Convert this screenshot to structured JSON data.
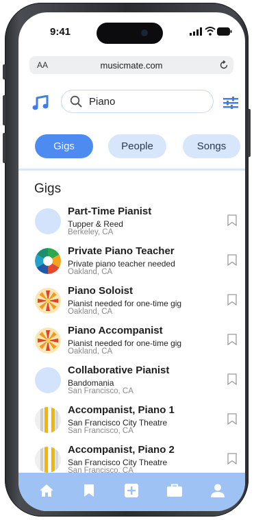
{
  "status_bar": {
    "time": "9:41",
    "indicators": "signal-wifi-battery"
  },
  "browser": {
    "text_size_label": "AA",
    "url": "musicmate.com",
    "reload_icon": "reload-icon"
  },
  "header": {
    "logo_icon": "music-note-icon",
    "search_value": "Piano",
    "search_icon": "search-icon",
    "filter_icon": "sliders-icon"
  },
  "tabs": [
    {
      "label": "Gigs",
      "active": true
    },
    {
      "label": "People",
      "active": false
    },
    {
      "label": "Songs",
      "active": false
    }
  ],
  "section": {
    "title": "Gigs"
  },
  "gigs": [
    {
      "title": "Part-Time Pianist",
      "subtitle": "Tupper & Reed",
      "location": "Berkeley, CA",
      "thumb": "plain"
    },
    {
      "title": "Private Piano Teacher",
      "subtitle": "Private piano teacher needed",
      "location": "Oakland, CA",
      "thumb": "color-wheel"
    },
    {
      "title": "Piano Soloist",
      "subtitle": "Pianist needed for one-time gig",
      "location": "Oakland, CA",
      "thumb": "star-burst"
    },
    {
      "title": "Piano Accompanist",
      "subtitle": "Pianist needed for one-time gig",
      "location": "Oakland, CA",
      "thumb": "star-burst"
    },
    {
      "title": "Collaborative Pianist",
      "subtitle": "Bandomania",
      "location": "San Francisco, CA",
      "thumb": "plain"
    },
    {
      "title": "Accompanist, Piano 1",
      "subtitle": "San Francisco City Theatre",
      "location": "San Francisco, CA",
      "thumb": "stripes"
    },
    {
      "title": "Accompanist, Piano 2",
      "subtitle": "San Francisco City Theatre",
      "location": "San Francisco, CA",
      "thumb": "stripes"
    }
  ],
  "tab_bar": {
    "icons": [
      "home-icon",
      "bookmark-icon",
      "add-icon",
      "briefcase-icon",
      "profile-icon"
    ]
  },
  "colors": {
    "accent": "#4d8bf1",
    "chip": "#d7e6fb",
    "tab_bar": "#9fc2f5",
    "divider": "#d9e6f7"
  }
}
